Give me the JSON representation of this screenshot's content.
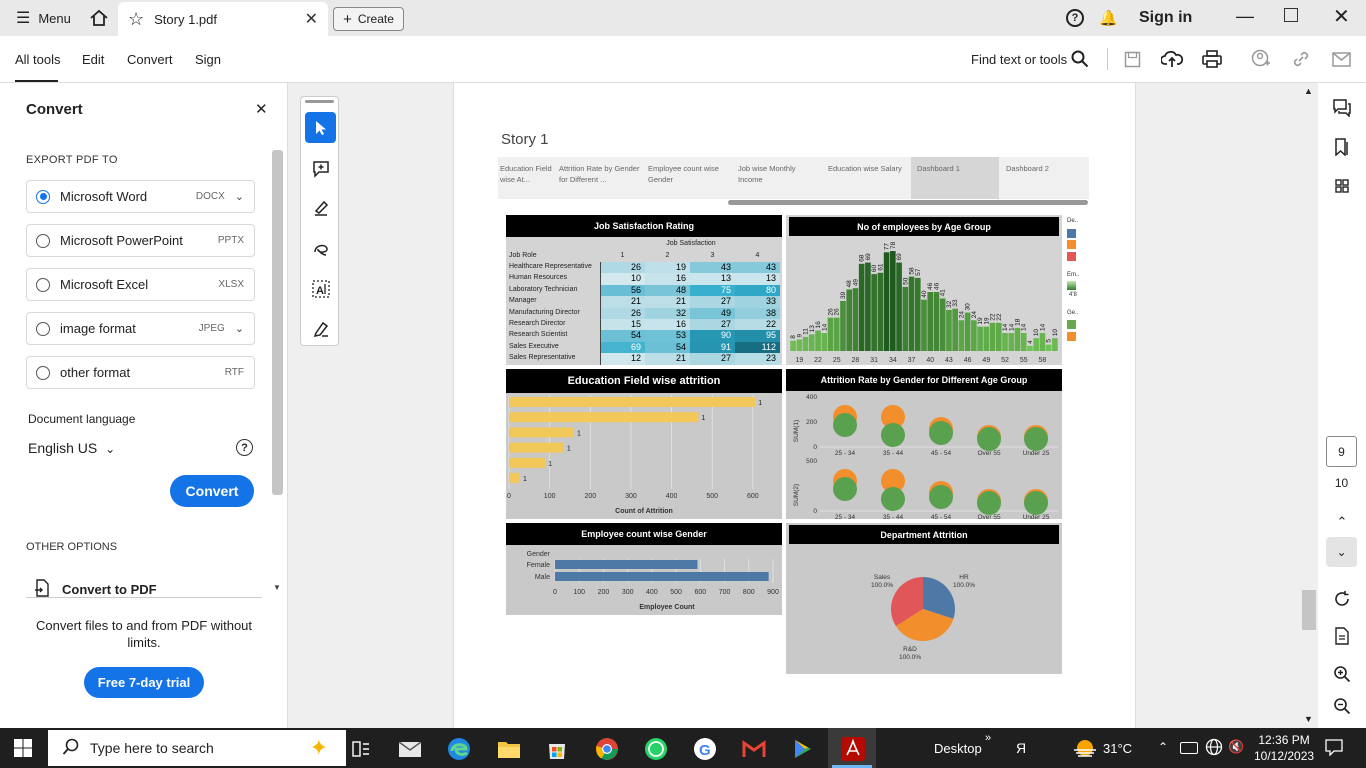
{
  "titlebar": {
    "menu_label": "Menu",
    "tab_title": "Story 1.pdf",
    "create_label": "Create",
    "signin_label": "Sign in"
  },
  "toolbar": {
    "tabs": [
      "All tools",
      "Edit",
      "Convert",
      "Sign"
    ],
    "find_label": "Find text or tools"
  },
  "panel": {
    "title": "Convert",
    "export_label": "EXPORT PDF TO",
    "options": [
      {
        "label": "Microsoft Word",
        "ext": "DOCX",
        "selected": true,
        "has_dropdown": true
      },
      {
        "label": "Microsoft PowerPoint",
        "ext": "PPTX",
        "selected": false,
        "has_dropdown": false
      },
      {
        "label": "Microsoft Excel",
        "ext": "XLSX",
        "selected": false,
        "has_dropdown": false
      },
      {
        "label": "image format",
        "ext": "JPEG",
        "selected": false,
        "has_dropdown": true
      },
      {
        "label": "other format",
        "ext": "RTF",
        "selected": false,
        "has_dropdown": false
      }
    ],
    "doc_lang_label": "Document language",
    "doc_lang_value": "English US",
    "convert_button": "Convert",
    "other_options_label": "OTHER OPTIONS",
    "convert_to_pdf": "Convert to PDF",
    "promo_text": "Convert files to and from PDF without limits.",
    "trial_button": "Free 7-day trial"
  },
  "document": {
    "story_title": "Story 1",
    "story_tabs": [
      "Education Field wise At...",
      "Attrition Rate by Gender for Different ...",
      "Employee count wise Gender",
      "Job wise Monthly Income",
      "Education wise Salary",
      "Dashboard 1",
      "Dashboard 2"
    ],
    "active_story_tab": 5
  },
  "chart_data": [
    {
      "type": "heatmap",
      "title": "Job Satisfaction Rating",
      "column_header": "Job Satisfaction",
      "row_header": "Job Role",
      "columns": [
        "1",
        "2",
        "3",
        "4"
      ],
      "rows": [
        "Healthcare Representative",
        "Human Resources",
        "Laboratory Technician",
        "Manager",
        "Manufacturing Director",
        "Research Director",
        "Research Scientist",
        "Sales Executive",
        "Sales Representative"
      ],
      "values": [
        [
          26,
          19,
          43,
          43
        ],
        [
          10,
          16,
          13,
          13
        ],
        [
          56,
          48,
          75,
          80
        ],
        [
          21,
          21,
          27,
          33
        ],
        [
          26,
          32,
          49,
          38
        ],
        [
          15,
          16,
          27,
          22
        ],
        [
          54,
          53,
          90,
          95
        ],
        [
          69,
          54,
          91,
          112
        ],
        [
          12,
          21,
          27,
          23
        ]
      ]
    },
    {
      "type": "bar",
      "title": "No of employees by Age Group",
      "categories": [
        "18",
        "19",
        "20",
        "21",
        "22",
        "23",
        "24",
        "25",
        "26",
        "27",
        "28",
        "29",
        "30",
        "31",
        "32",
        "33",
        "34",
        "35",
        "36",
        "37",
        "38",
        "39",
        "40",
        "41",
        "42",
        "43",
        "44",
        "45",
        "46",
        "47",
        "48",
        "49",
        "50",
        "51",
        "52",
        "53",
        "54",
        "55",
        "56",
        "57",
        "58",
        "59",
        "60"
      ],
      "values": [
        8,
        9,
        11,
        13,
        16,
        14,
        26,
        26,
        39,
        48,
        49,
        68,
        69,
        60,
        61,
        77,
        78,
        69,
        50,
        58,
        57,
        40,
        46,
        46,
        41,
        32,
        33,
        24,
        30,
        24,
        19,
        19,
        22,
        22,
        14,
        14,
        18,
        14,
        4,
        10,
        14,
        5,
        10
      ],
      "xticks": [
        "19",
        "22",
        "25",
        "28",
        "31",
        "34",
        "37",
        "40",
        "43",
        "46",
        "49",
        "52",
        "55",
        "58"
      ],
      "legend_labels": [
        "De..",
        "Em..",
        "4'8",
        "Ge.."
      ]
    },
    {
      "type": "bar",
      "title": "Education Field wise attrition",
      "orientation": "horizontal",
      "values": [
        606,
        466,
        160,
        135,
        89,
        27
      ],
      "data_labels": [
        "1",
        "1",
        "1",
        "1",
        "1",
        "1"
      ],
      "xticks": [
        "0",
        "100",
        "200",
        "300",
        "400",
        "500",
        "600"
      ],
      "xlabel": "Count of Attrition"
    },
    {
      "type": "scatter",
      "title": "Attrition Rate by Gender for Different Age Group",
      "categories": [
        "25 - 34",
        "35 - 44",
        "45 - 54",
        "Over 55",
        "Under 25"
      ],
      "series": [
        {
          "ylabel": "SUM(1)",
          "yticks": [
            "0",
            "200",
            "400"
          ]
        },
        {
          "ylabel": "SUM(2)",
          "yticks": [
            "0",
            "500"
          ]
        }
      ]
    },
    {
      "type": "bar",
      "title": "Employee count wise Gender",
      "orientation": "horizontal",
      "row_header": "Gender",
      "categories": [
        "Female",
        "Male"
      ],
      "values": [
        588,
        882
      ],
      "xticks": [
        "0",
        "100",
        "200",
        "300",
        "400",
        "500",
        "600",
        "700",
        "800",
        "900"
      ],
      "xlabel": "Employee Count"
    },
    {
      "type": "pie",
      "title": "Department  Attrition",
      "slices": [
        {
          "label": "HR",
          "pct_label": "100.0%",
          "value": 4.3,
          "color": "#4e79a7"
        },
        {
          "label": "R&D",
          "pct_label": "100.0%",
          "value": 65.4,
          "color": "#f28e2b"
        },
        {
          "label": "Sales",
          "pct_label": "100.0%",
          "value": 30.3,
          "color": "#e15759"
        }
      ]
    }
  ],
  "rightbar": {
    "page_current": "9",
    "page_total": "10"
  },
  "taskbar": {
    "search_placeholder": "Type here to search",
    "desktop_label": "Desktop",
    "temperature": "31°C",
    "time": "12:36 PM",
    "date": "10/12/2023"
  }
}
